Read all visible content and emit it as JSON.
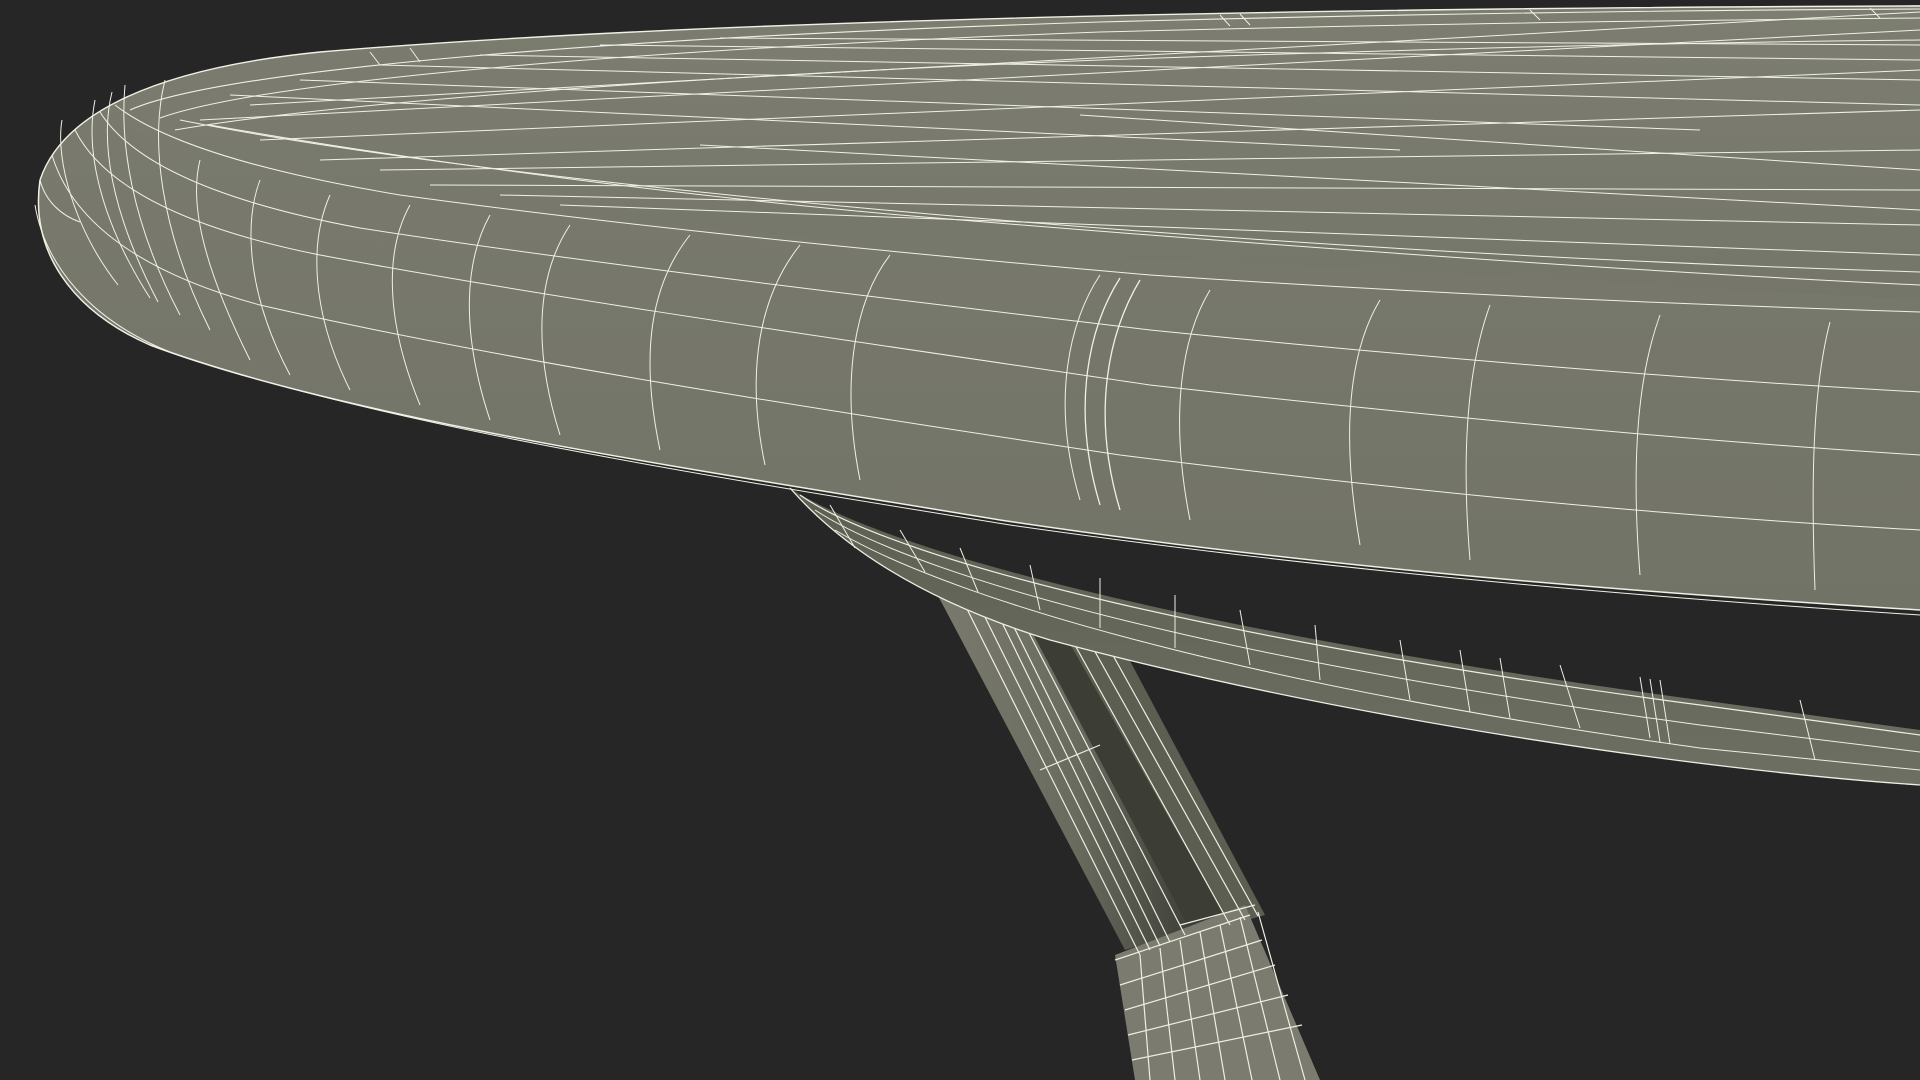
{
  "scene": {
    "subject": "wireframe-render",
    "colors": {
      "background": "#262626",
      "surface": "#7a7b6e",
      "surface_shadow": "#55574c",
      "surface_dark": "#3e4038",
      "wire": "#f2f2e6"
    }
  }
}
